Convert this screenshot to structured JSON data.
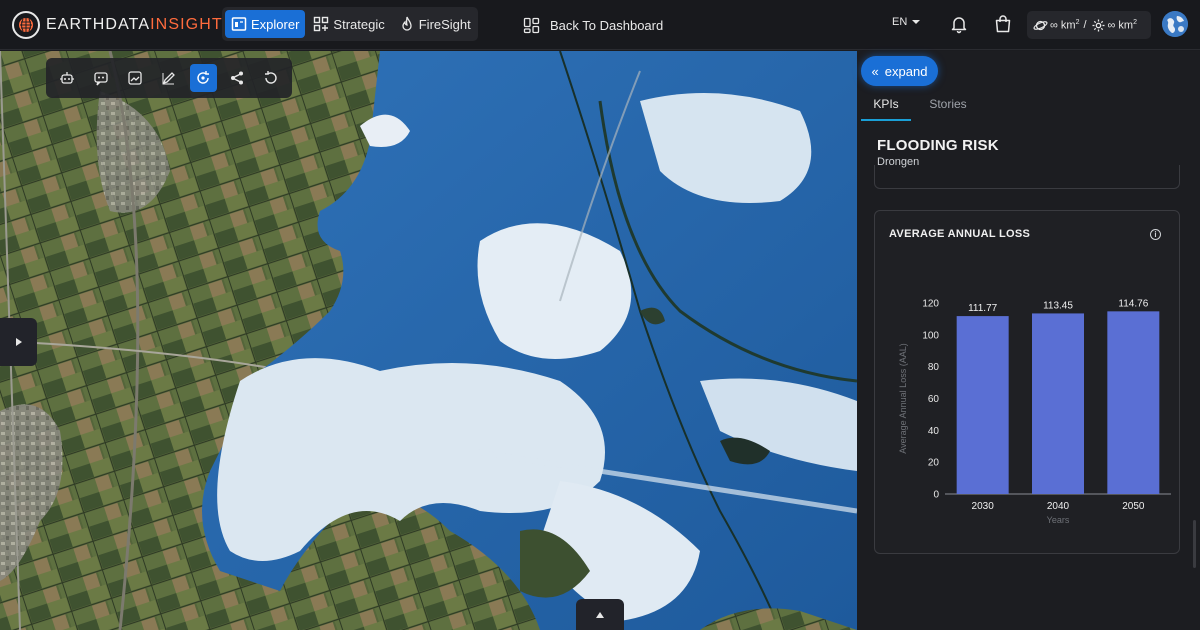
{
  "brand": {
    "name_a": "EARTHDATA",
    "name_b": "INSIGHTS"
  },
  "nav": {
    "items": [
      {
        "label": "Explorer",
        "active": true
      },
      {
        "label": "Strategic",
        "active": false
      },
      {
        "label": "FireSight",
        "active": false
      }
    ],
    "back_label": "Back To Dashboard"
  },
  "header": {
    "language": "EN",
    "quota_a": "∞ km",
    "quota_sep": "/",
    "quota_b": "∞ km",
    "unit_sup": "2"
  },
  "panel": {
    "expand_label": "expand",
    "tabs": [
      {
        "label": "KPIs",
        "active": true
      },
      {
        "label": "Stories",
        "active": false
      }
    ],
    "title": "FLOODING RISK",
    "subtitle": "Drongen",
    "card_title": "AVERAGE ANNUAL LOSS",
    "info_symbol": "i"
  },
  "chart_data": {
    "type": "bar",
    "categories": [
      "2030",
      "2040",
      "2050"
    ],
    "values": [
      111.77,
      113.45,
      114.76
    ],
    "value_labels": [
      "111.77",
      "113.45",
      "114.76"
    ],
    "xlabel": "Years",
    "ylabel": "Average Annual Loss (AAL)",
    "ylim": [
      0,
      120
    ],
    "yticks": [
      0,
      20,
      40,
      60,
      80,
      100,
      120
    ],
    "bar_color": "#5a6fd4",
    "grid": false
  },
  "colors": {
    "accent": "#1a6fd6",
    "brand_accent": "#ff6b3d"
  }
}
